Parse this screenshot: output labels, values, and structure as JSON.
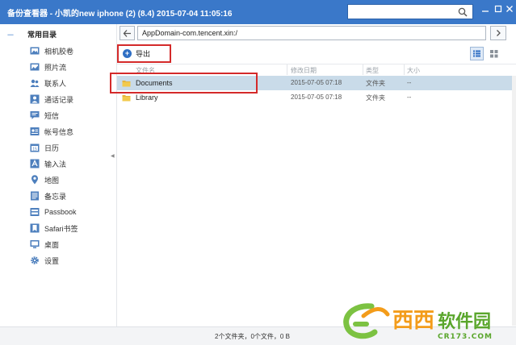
{
  "window": {
    "title": "备份查看器 - 小凯的new iphone (2) (8.4) 2015-07-04 11:05:16",
    "search_placeholder": "",
    "controls": [
      "minimize",
      "maximize",
      "close"
    ]
  },
  "sidebar": {
    "header": "常用目录",
    "items": [
      {
        "label": "相机胶卷",
        "icon": "photo-icon"
      },
      {
        "label": "照片流",
        "icon": "photostream-icon"
      },
      {
        "label": "联系人",
        "icon": "contacts-icon"
      },
      {
        "label": "通话记录",
        "icon": "call-log-icon"
      },
      {
        "label": "短信",
        "icon": "sms-icon"
      },
      {
        "label": "帐号信息",
        "icon": "account-icon"
      },
      {
        "label": "日历",
        "icon": "calendar-icon"
      },
      {
        "label": "输入法",
        "icon": "keyboard-icon"
      },
      {
        "label": "地图",
        "icon": "map-pin-icon"
      },
      {
        "label": "备忘录",
        "icon": "notes-icon"
      },
      {
        "label": "Passbook",
        "icon": "passbook-icon"
      },
      {
        "label": "Safari书签",
        "icon": "bookmark-icon"
      },
      {
        "label": "桌面",
        "icon": "desktop-icon"
      },
      {
        "label": "设置",
        "icon": "gear-icon"
      }
    ]
  },
  "path": {
    "value": "AppDomain-com.tencent.xin:/"
  },
  "toolbar": {
    "export_label": "导出"
  },
  "table": {
    "columns": [
      "文件名",
      "修改日期",
      "类型",
      "大小"
    ],
    "rows": [
      {
        "name": "Documents",
        "date": "2015-07-05 07:18",
        "type": "文件夹",
        "size": "--",
        "selected": true
      },
      {
        "name": "Library",
        "date": "2015-07-05 07:18",
        "type": "文件夹",
        "size": "--",
        "selected": false
      }
    ]
  },
  "status": {
    "text": "2个文件夹，0个文件，0 B"
  },
  "watermark": {
    "main": "西西软件园",
    "sub": "CR173.COM"
  },
  "colors": {
    "titlebar": "#3a78c9",
    "accent": "#2f6fc4",
    "selection": "#c9dbe9",
    "highlight_box": "#d42a2a"
  }
}
